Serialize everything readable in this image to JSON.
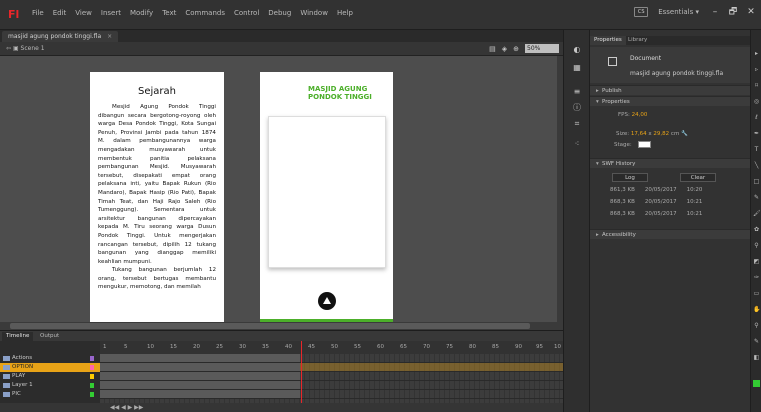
{
  "app": {
    "logo": "Fl"
  },
  "menu": [
    "File",
    "Edit",
    "View",
    "Insert",
    "Modify",
    "Text",
    "Commands",
    "Control",
    "Debug",
    "Window",
    "Help"
  ],
  "top_right": {
    "workspace_icon": "CS",
    "workspace": "Essentials ▾",
    "minimize": "–",
    "restore": "🗗",
    "close": "✕"
  },
  "doc_tab": {
    "name": "masjid agung pondok tinggi.fla",
    "close": "×"
  },
  "editbar": {
    "scene": "Scene 1",
    "zoom": "50%"
  },
  "article": {
    "title": "Sejarah",
    "paragraphs": [
      "Mesjid Agung Pondok Tinggi dibangun secara bergotong-royong oleh warga Desa Pondok Tinggi, Kota Sungai Penuh, Provinsi Jambi pada tahun 1874 M. dalam pembangunannya warga mengadakan musyawarah untuk membentuk panitia pelaksana pembangunan Mesjid. Musyawarah tersebut, disepakati empat orang pelaksana inti, yaitu Bapak Rukun (Rio Mandaro), Bapak Hasip (Rio Pati), Bapak Timah Teat, dan Haji Rajo Saleh (Rio Tumenggung). Sementara untuk arsitektur bangunan dipercayakan kepada M. Tiru seorang warga Dusun Pondok Tinggi. Untuk mengerjakan rancangan tersebut, dipilih 12 tukang bangunan yang dianggap memiliki keahlian mumpuni.",
      "Tukang bangunan berjumlah 12 orang, tersebut bertugas membantu mengukur, memotong, dan memilah"
    ]
  },
  "phone": {
    "title_line1": "MASJID AGUNG",
    "title_line2": "PONDOK TINGGI"
  },
  "timeline": {
    "tabs": [
      "Timeline",
      "Output"
    ],
    "frame_numbers": [
      "1",
      "5",
      "10",
      "15",
      "20",
      "25",
      "30",
      "35",
      "40",
      "45",
      "50",
      "55",
      "60",
      "65",
      "70",
      "75",
      "80",
      "85",
      "90",
      "95",
      "10"
    ],
    "playhead_label": "45",
    "layers": [
      {
        "name": "Actions",
        "color": "#9966cc"
      },
      {
        "name": "OPTION",
        "color": "#ff66aa"
      },
      {
        "name": "PLAY",
        "color": "#ffcc00"
      },
      {
        "name": "Layer 1",
        "color": "#33cc33"
      },
      {
        "name": "PIC",
        "color": "#33cc33"
      }
    ]
  },
  "properties": {
    "tabs": [
      "Properties",
      "Library"
    ],
    "doc_type": "Document",
    "doc_name": "masjid agung pondok tinggi.fla",
    "sections": {
      "publish": "Publish",
      "properties": "Properties",
      "swf_history": "SWF History",
      "accessibility": "Accessibility"
    },
    "fps_label": "FPS:",
    "fps": "24,00",
    "size_label": "Size:",
    "width": "17,64",
    "x": "x",
    "height": "29,82",
    "unit": "cm",
    "stage_label": "Stage:",
    "log_button": "Log",
    "clear_button": "Clear",
    "history": [
      {
        "size": "861,3 KB",
        "date": "20/05/2017",
        "time": "10:20"
      },
      {
        "size": "868,3 KB",
        "date": "20/05/2017",
        "time": "10:21"
      },
      {
        "size": "868,3 KB",
        "date": "20/05/2017",
        "time": "10:21"
      }
    ]
  },
  "colors": {
    "accent_orange": "#e8a317",
    "phone_green": "#4caf2a",
    "flash_red": "#e8262a"
  }
}
